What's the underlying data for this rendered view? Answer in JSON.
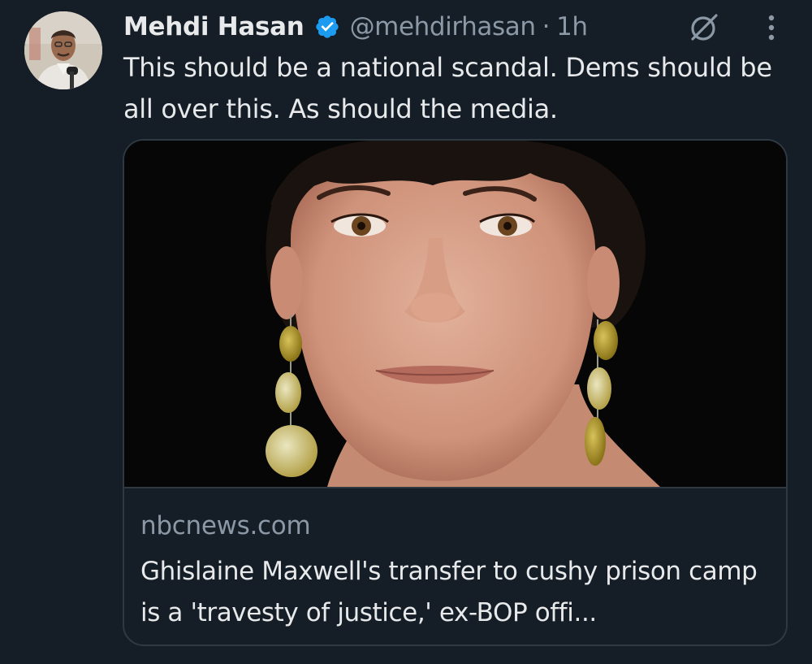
{
  "post": {
    "author": {
      "display_name": "Mehdi Hasan",
      "handle": "@mehdirhasan",
      "verified": true
    },
    "separator": "·",
    "time": "1h",
    "text": "This should be a national scandal. Dems should be all over this. As should the media.",
    "actions": {
      "grok_icon": "grok-icon",
      "more_icon": "more-vertical-icon"
    }
  },
  "link_card": {
    "domain": "nbcnews.com",
    "title": "Ghislaine Maxwell's transfer to cushy prison camp is a 'travesty of justice,' ex-BOP offi..."
  },
  "colors": {
    "background": "#151d27",
    "text_primary": "#e7e9ea",
    "text_secondary": "#8b98a5",
    "verified_blue": "#1d9bf0",
    "card_border": "#2f3942"
  }
}
